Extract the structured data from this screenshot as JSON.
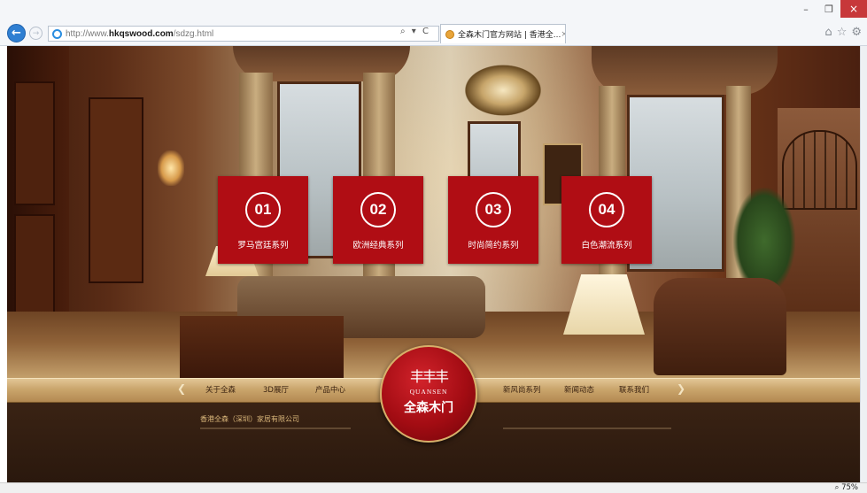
{
  "browser": {
    "url_prefix": "http://www.",
    "url_domain": "hkqswood.com",
    "url_path": "/sdzg.html",
    "addr_tools": "⌕ ▾ C",
    "tab_title": "全森木门官方网站 | 香港全...",
    "tab_close": "×",
    "win_min": "–",
    "win_max": "❐",
    "win_close": "×",
    "tools": [
      "⌂",
      "☆",
      "⚙"
    ],
    "zoom": "⌕ 75%"
  },
  "tiles": [
    {
      "number": "01",
      "label": "罗马宫廷系列"
    },
    {
      "number": "02",
      "label": "欧洲经典系列"
    },
    {
      "number": "03",
      "label": "时尚简约系列"
    },
    {
      "number": "04",
      "label": "白色潮流系列"
    }
  ],
  "nav": {
    "left": [
      "关于全森",
      "3D展厅",
      "产品中心"
    ],
    "right": [
      "新风尚系列",
      "新闻动态",
      "联系我们"
    ],
    "arrow_left": "❮",
    "arrow_right": "❯"
  },
  "logo": {
    "mark": "丰丰丰",
    "english": "QUANSEN",
    "chinese": "全森木门"
  },
  "footer": {
    "company": "香港全森（深圳）家居有限公司"
  },
  "colors": {
    "tile_red": "#b00d14",
    "nav_gold": "#caa56c",
    "footer_brown": "#2a180d"
  }
}
